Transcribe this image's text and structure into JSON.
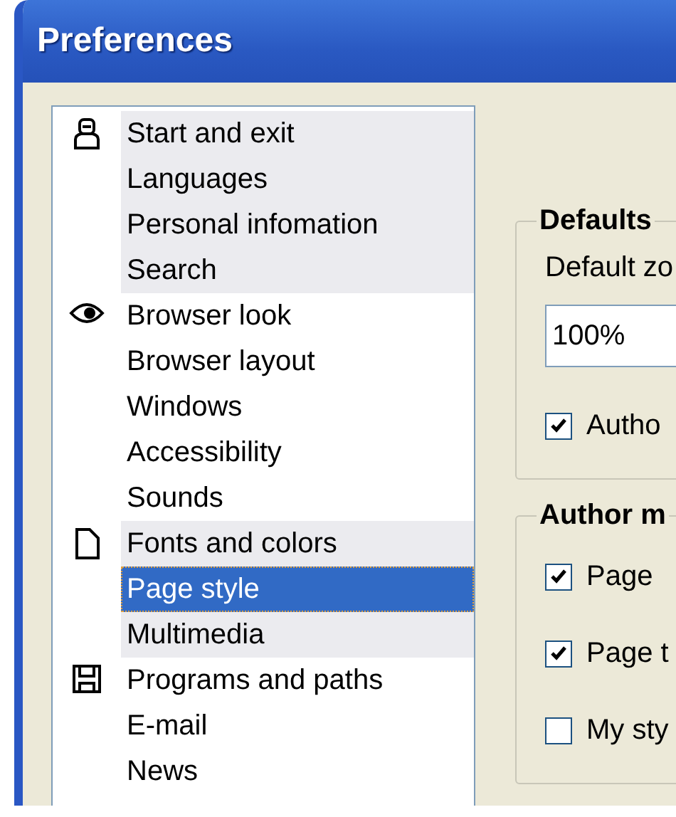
{
  "window": {
    "title": "Preferences"
  },
  "sidebar": {
    "groups": [
      {
        "highlighted": true,
        "items": [
          {
            "label": "Start and exit",
            "selected": false
          },
          {
            "label": "Languages",
            "selected": false
          },
          {
            "label": "Personal infomation",
            "selected": false
          },
          {
            "label": "Search",
            "selected": false
          }
        ]
      },
      {
        "highlighted": false,
        "items": [
          {
            "label": "Browser look",
            "selected": false
          },
          {
            "label": "Browser layout",
            "selected": false
          },
          {
            "label": "Windows",
            "selected": false
          },
          {
            "label": "Accessibility",
            "selected": false
          },
          {
            "label": "Sounds",
            "selected": false
          }
        ]
      },
      {
        "highlighted": true,
        "items": [
          {
            "label": "Fonts and colors",
            "selected": false
          },
          {
            "label": "Page style",
            "selected": true
          },
          {
            "label": "Multimedia",
            "selected": false
          }
        ]
      },
      {
        "highlighted": false,
        "items": [
          {
            "label": "Programs and paths",
            "selected": false
          },
          {
            "label": "E-mail",
            "selected": false
          },
          {
            "label": "News",
            "selected": false
          }
        ]
      }
    ]
  },
  "defaults": {
    "title": "Defaults",
    "zoom_label": "Default zo",
    "zoom_value": "100%",
    "checkboxes": [
      {
        "label": "Autho",
        "checked": true
      }
    ]
  },
  "author_mode": {
    "title": "Author m",
    "checkboxes": [
      {
        "label": "Page",
        "checked": true
      },
      {
        "label": "Page t",
        "checked": true
      },
      {
        "label": "My sty",
        "checked": false
      }
    ]
  }
}
